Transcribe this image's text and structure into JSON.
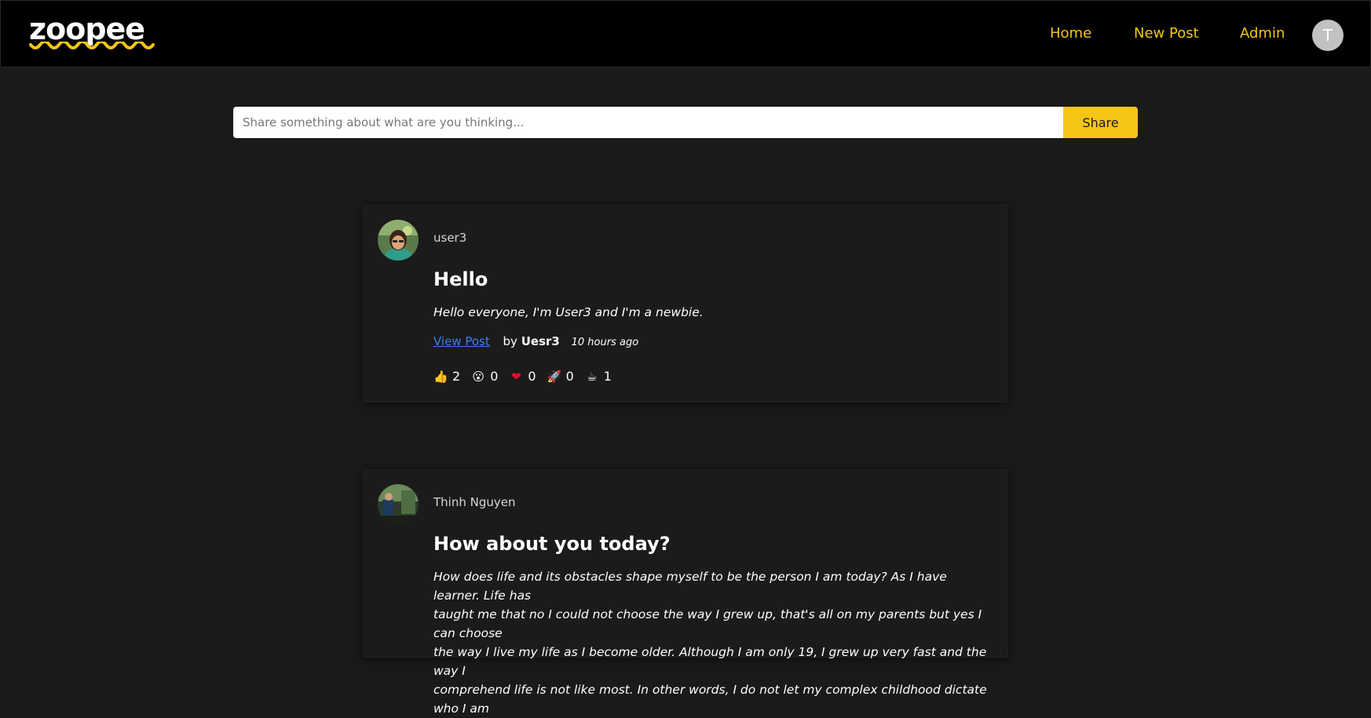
{
  "brand": {
    "logo_text": "zoopee",
    "accent": "#f5c518",
    "wave_color": "#f5c518"
  },
  "nav": {
    "home": "Home",
    "new_post": "New Post",
    "admin": "Admin",
    "avatar_initial": "T"
  },
  "share": {
    "placeholder": "Share something about what are you thinking...",
    "button": "Share"
  },
  "posts": [
    {
      "username": "user3",
      "title": "Hello",
      "body": "Hello everyone, I'm User3 and I'm a newbie.",
      "view_link": "View Post",
      "by_label": "by",
      "author": "Uesr3",
      "time": "10 hours ago",
      "reactions": [
        {
          "icon": "thumbs-up-icon",
          "glyph": "👍",
          "count": "2"
        },
        {
          "icon": "surprised-face-icon",
          "glyph": "😮",
          "count": "0"
        },
        {
          "icon": "heart-icon",
          "glyph": "❤",
          "count": "0"
        },
        {
          "icon": "rocket-icon",
          "glyph": "🚀",
          "count": "0"
        },
        {
          "icon": "coffee-icon",
          "glyph": "☕",
          "count": "1"
        }
      ]
    },
    {
      "username": "Thinh Nguyen",
      "title": "How about you today?",
      "body_lines": [
        "How does life and its obstacles shape myself to be the person I am today? As I have learner. Life has",
        "taught me that no I could not choose the way I grew up, that's all on my parents but yes I can choose",
        "the way I live my life as I become older. Although I am only 19, I grew up very fast and the way I",
        "comprehend life is not like most. In other words, I do not let my complex childhood dictate who I am"
      ]
    }
  ]
}
